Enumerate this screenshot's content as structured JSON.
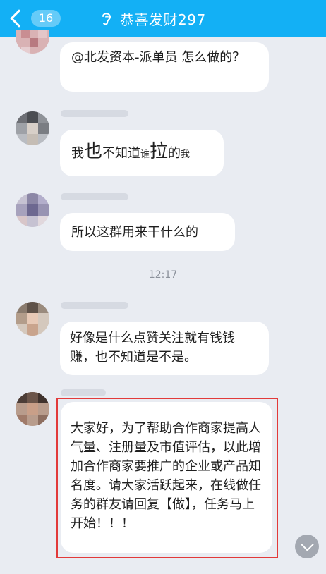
{
  "header": {
    "unread_count": "16",
    "title": "恭喜发财297",
    "bg_color": "#13b0f5"
  },
  "messages": [
    {
      "text": "@北发资本-派单员 怎么做的？"
    },
    {
      "parts": [
        "我",
        "也",
        "不知道",
        "谁",
        "拉",
        "的",
        "我"
      ]
    },
    {
      "text": "所以这群用来干什么的"
    },
    {
      "text": "好像是什么点赞关注就有钱钱赚，也不知道是不是。"
    },
    {
      "text": "大家好，为了帮助合作商家提高人气量、注册量及市值评估，以此增加合作商家要推广的企业或产品知名度。请大家活跃起来，在线做任务的群友请回复【做】，任务马上开始！！！"
    }
  ],
  "timestamp": "12:17",
  "highlight_color": "#e23a3a"
}
